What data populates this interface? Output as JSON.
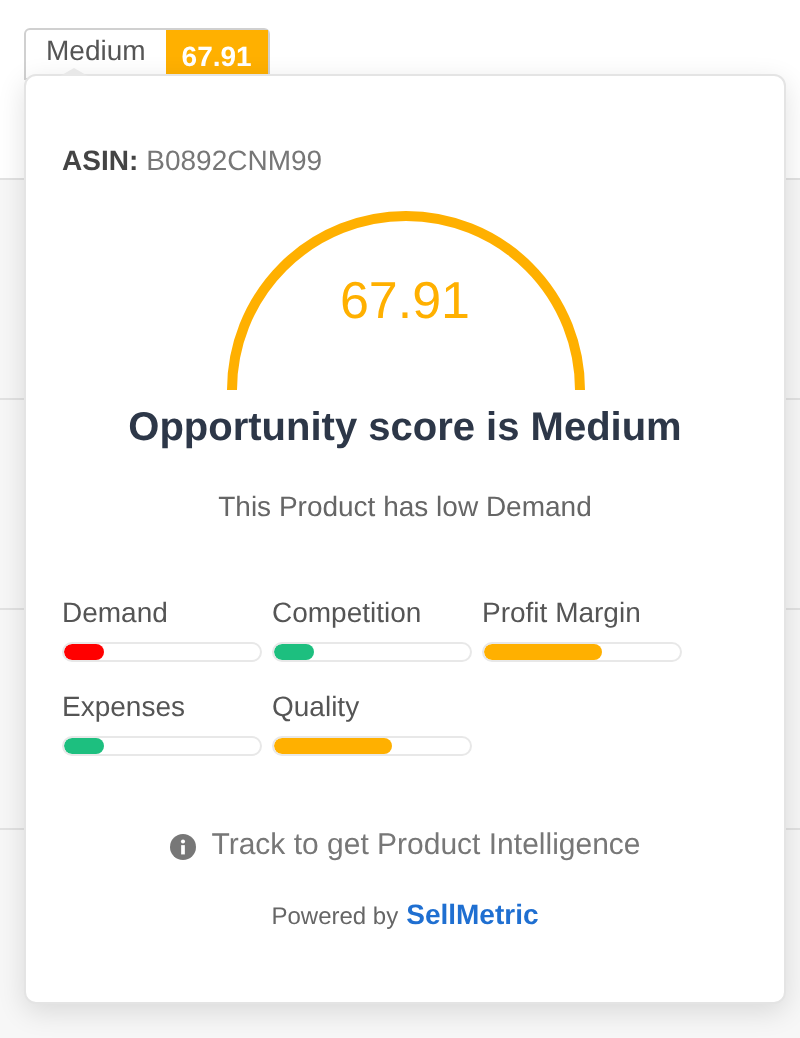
{
  "table_row": {
    "opportunity_label": "Medium",
    "opportunity_score": "67.91"
  },
  "popover": {
    "asin_label": "ASIN:",
    "asin": "B0892CNM99",
    "score": "67.91",
    "headline": "Opportunity score is Medium",
    "subtitle": "This Product has low Demand",
    "metrics": [
      {
        "label": "Demand",
        "level": 0.2,
        "color": "#ff0000"
      },
      {
        "label": "Competition",
        "level": 0.2,
        "color": "#1dbf7f"
      },
      {
        "label": "Profit Margin",
        "level": 0.6,
        "color": "#ffb000"
      },
      {
        "label": "Expenses",
        "level": 0.2,
        "color": "#1dbf7f"
      },
      {
        "label": "Quality",
        "level": 0.6,
        "color": "#ffb000"
      }
    ],
    "track_hint": "Track to get Product Intelligence",
    "powered_by": "Powered by",
    "brand": "SellMetric"
  }
}
